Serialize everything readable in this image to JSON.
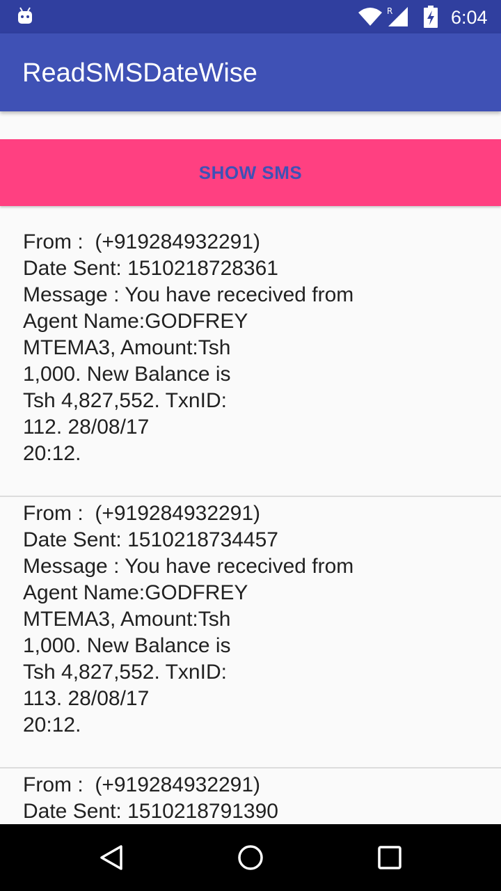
{
  "status_bar": {
    "time": "6:04",
    "icons": [
      "android-icon",
      "wifi-icon",
      "signal-icon",
      "battery-icon"
    ]
  },
  "app_bar": {
    "title": "ReadSMSDateWise"
  },
  "show_button": {
    "label": "SHOW SMS"
  },
  "sms_list": [
    {
      "lines": [
        "From :  (+919284932291)",
        "Date Sent: 1510218728361",
        "Message : You have rececived from",
        "Agent Name:GODFREY",
        "MTEMA3, Amount:Tsh",
        "1,000. New Balance is",
        "Tsh 4,827,552. TxnID:",
        "112. 28/08/17",
        "20:12."
      ]
    },
    {
      "lines": [
        "From :  (+919284932291)",
        "Date Sent: 1510218734457",
        "Message : You have rececived from",
        "Agent Name:GODFREY",
        "MTEMA3, Amount:Tsh",
        "1,000. New Balance is",
        "Tsh 4,827,552. TxnID:",
        "113. 28/08/17",
        "20:12."
      ]
    },
    {
      "lines": [
        "From :  (+919284932291)",
        "Date Sent: 1510218791390"
      ]
    }
  ],
  "colors": {
    "status_bar": "#303f9f",
    "app_bar": "#3f51b5",
    "accent": "#ff4081",
    "button_text": "#3f51b5"
  },
  "nav_bar": {
    "icons": [
      "back-icon",
      "home-icon",
      "recents-icon"
    ]
  }
}
